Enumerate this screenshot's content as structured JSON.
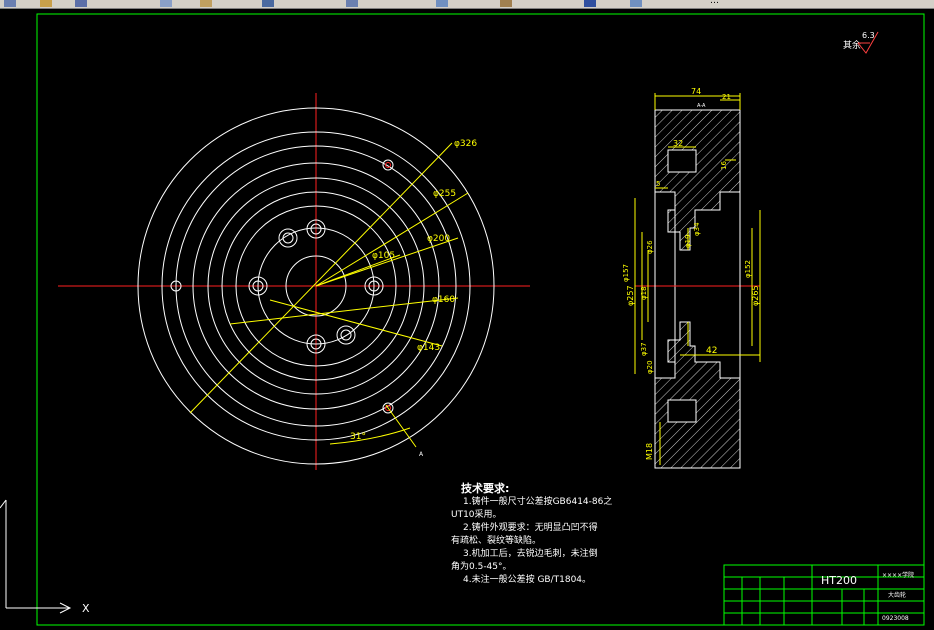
{
  "toolbar": {
    "title_fragment": "…"
  },
  "colors": {
    "background": "#000000",
    "line": "#ffffff",
    "center": "#ff2020",
    "dim": "#ffff00",
    "frame": "#00ff00",
    "hatch": "#ffffff"
  },
  "roughness": {
    "label": "其余",
    "value": "6.3"
  },
  "front_view": {
    "dims": {
      "d326": "φ326",
      "d255": "φ255",
      "d200": "φ200",
      "d105": "φ105",
      "d160": "φ160",
      "d143": "φ143",
      "angle31": "31°"
    },
    "marker_a": "A"
  },
  "section_view": {
    "dims": {
      "w74": "74",
      "w21": "21",
      "w32": "32",
      "w5": "5",
      "w42": "42",
      "d16": "16",
      "v257": "φ257",
      "v157": "φ157",
      "v26": "φ26",
      "v18": "φ18",
      "v34": "φ34",
      "v19": "φ19",
      "v152": "φ152",
      "v265": "φ265",
      "v37": "φ37",
      "v20": "φ20",
      "m18": "M18"
    },
    "aa_label": "A-A"
  },
  "tech": {
    "title": "技术要求:",
    "line1": "1.铸件一般尺寸公差按GB6414-86之",
    "line1b": "UT10采用。",
    "line2": "2.铸件外观要求：无明显凸凹不得",
    "line2b": "有疏松、裂纹等缺陷。",
    "line3": "3.机加工后，去锐边毛刺，未注倒",
    "line3b": "角为0.5-45°。",
    "line4": "4.未注一般公差按 GB/T1804。"
  },
  "title_block": {
    "material": "HT200",
    "school": "××××学院",
    "part": "大齿轮",
    "code": "0923008"
  },
  "ucs": {
    "x_label": "X"
  }
}
